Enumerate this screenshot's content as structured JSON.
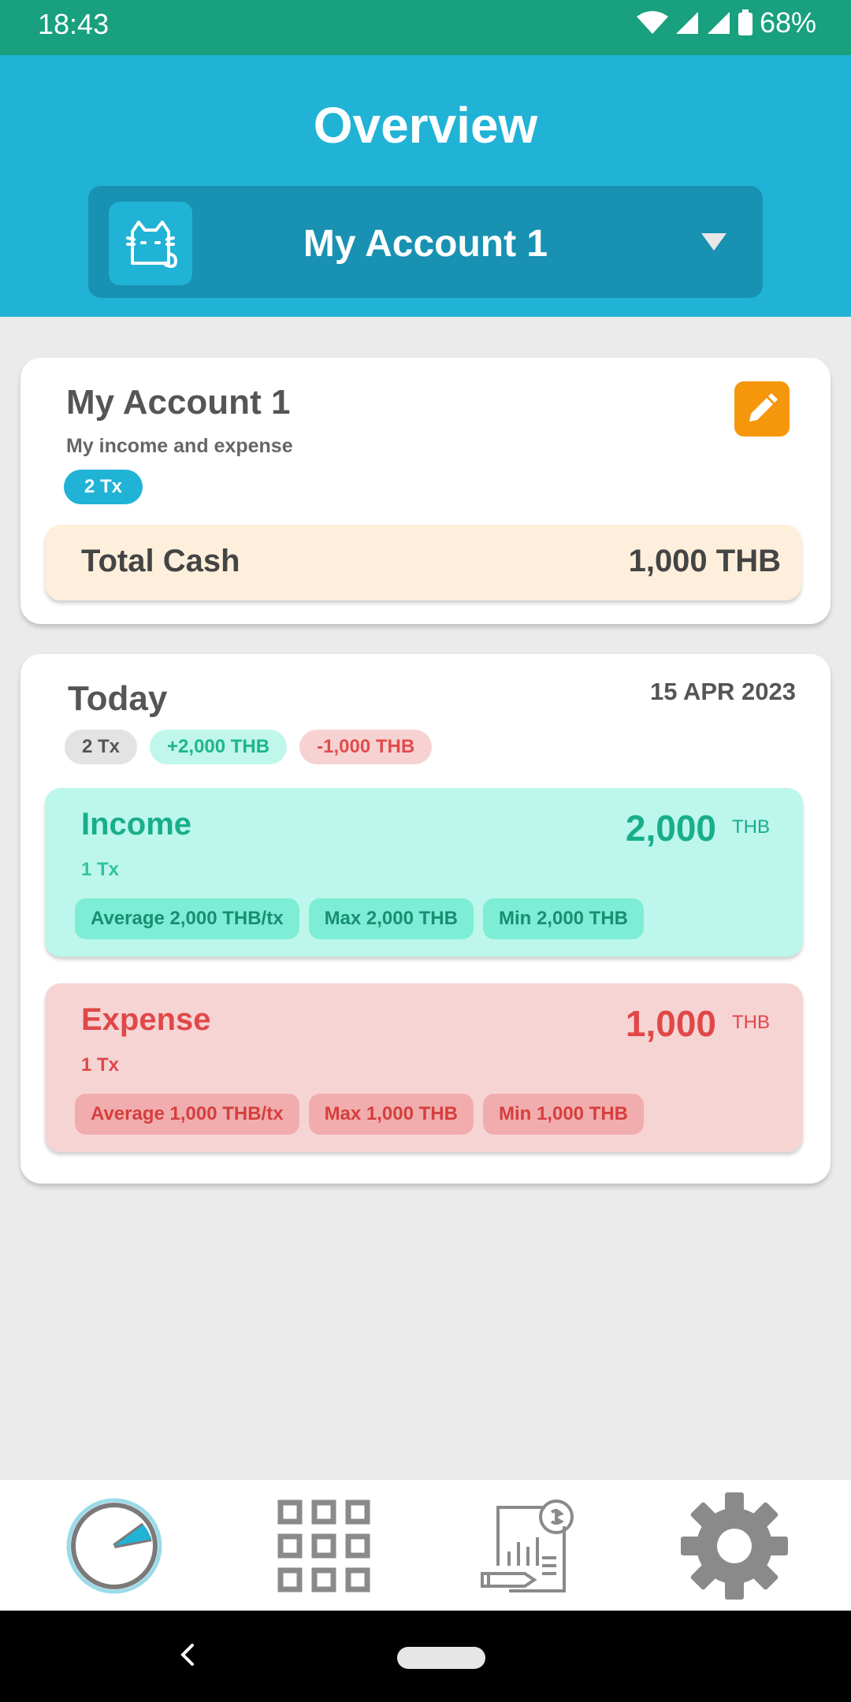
{
  "status_bar": {
    "time": "18:43",
    "battery": "68%"
  },
  "header": {
    "title": "Overview",
    "account_selector": {
      "selected": "My Account 1"
    }
  },
  "account_card": {
    "name": "My Account 1",
    "description": "My income and expense",
    "tx_badge": "2 Tx",
    "total_label": "Total Cash",
    "total_value": "1,000 THB",
    "edit_color": "#f6960a"
  },
  "today_card": {
    "label": "Today",
    "date": "15 APR 2023",
    "pills": {
      "tx": "2 Tx",
      "income": "+2,000 THB",
      "expense": "-1,000 THB"
    },
    "income": {
      "title": "Income",
      "amount": "2,000",
      "unit": "THB",
      "count": "1 Tx",
      "chips": [
        "Average 2,000 THB/tx",
        "Max 2,000 THB",
        "Min 2,000 THB"
      ]
    },
    "expense": {
      "title": "Expense",
      "amount": "1,000",
      "unit": "THB",
      "count": "1 Tx",
      "chips": [
        "Average 1,000 THB/tx",
        "Max 1,000 THB",
        "Min 1,000 THB"
      ]
    }
  },
  "bottom_nav": {
    "items": [
      "pie-chart-icon",
      "grid-icon",
      "report-icon",
      "gear-icon"
    ],
    "active": "pie-chart-icon"
  },
  "colors": {
    "status_bar": "#19a07e",
    "header": "#20b3d6",
    "income": "#18ae8a",
    "expense": "#e04848"
  }
}
